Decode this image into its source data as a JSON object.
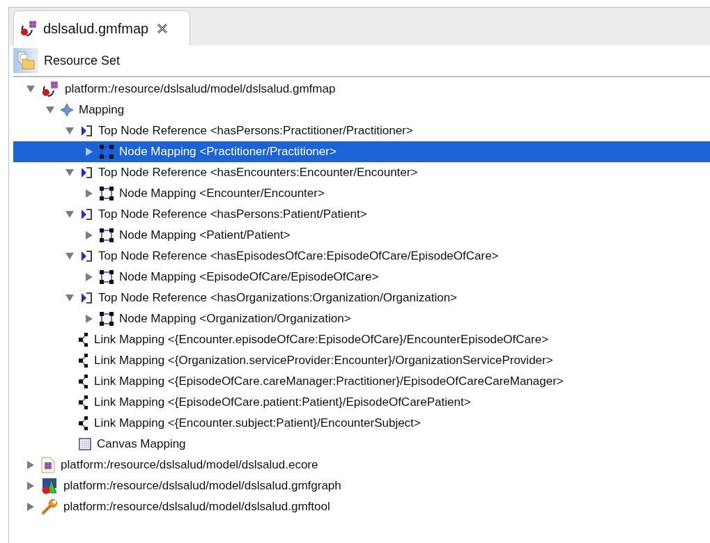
{
  "tab": {
    "title": "dslsalud.gmfmap",
    "selected": true
  },
  "header": {
    "label": "Resource Set"
  },
  "tree": [
    {
      "kind": "gmfmap",
      "label": "platform:/resource/dslsalud/model/dslsalud.gmfmap",
      "expanded": true,
      "selected": false,
      "children": [
        {
          "kind": "mapping",
          "label": "Mapping",
          "expanded": true,
          "selected": false,
          "children": [
            {
              "kind": "top-node",
              "label": "Top Node Reference <hasPersons:Practitioner/Practitioner>",
              "expanded": true,
              "selected": false,
              "children": [
                {
                  "kind": "node",
                  "label": "Node Mapping <Practitioner/Practitioner>",
                  "expanded": false,
                  "selected": true
                }
              ]
            },
            {
              "kind": "top-node",
              "label": "Top Node Reference <hasEncounters:Encounter/Encounter>",
              "expanded": true,
              "selected": false,
              "children": [
                {
                  "kind": "node",
                  "label": "Node Mapping <Encounter/Encounter>",
                  "expanded": false,
                  "selected": false
                }
              ]
            },
            {
              "kind": "top-node",
              "label": "Top Node Reference <hasPersons:Patient/Patient>",
              "expanded": true,
              "selected": false,
              "children": [
                {
                  "kind": "node",
                  "label": "Node Mapping <Patient/Patient>",
                  "expanded": false,
                  "selected": false
                }
              ]
            },
            {
              "kind": "top-node",
              "label": "Top Node Reference <hasEpisodesOfCare:EpisodeOfCare/EpisodeOfCare>",
              "expanded": true,
              "selected": false,
              "children": [
                {
                  "kind": "node",
                  "label": "Node Mapping <EpisodeOfCare/EpisodeOfCare>",
                  "expanded": false,
                  "selected": false
                }
              ]
            },
            {
              "kind": "top-node",
              "label": "Top Node Reference <hasOrganizations:Organization/Organization>",
              "expanded": true,
              "selected": false,
              "children": [
                {
                  "kind": "node",
                  "label": "Node Mapping <Organization/Organization>",
                  "expanded": false,
                  "selected": false
                }
              ]
            },
            {
              "kind": "link",
              "label": "Link Mapping <{Encounter.episodeOfCare:EpisodeOfCare}/EncounterEpisodeOfCare>",
              "selected": false
            },
            {
              "kind": "link",
              "label": "Link Mapping <{Organization.serviceProvider:Encounter}/OrganizationServiceProvider>",
              "selected": false
            },
            {
              "kind": "link",
              "label": "Link Mapping <{EpisodeOfCare.careManager:Practitioner}/EpisodeOfCareCareManager>",
              "selected": false
            },
            {
              "kind": "link",
              "label": "Link Mapping <{EpisodeOfCare.patient:Patient}/EpisodeOfCarePatient>",
              "selected": false
            },
            {
              "kind": "link",
              "label": "Link Mapping <{Encounter.subject:Patient}/EncounterSubject>",
              "selected": false
            },
            {
              "kind": "canvas",
              "label": "Canvas Mapping",
              "selected": false
            }
          ]
        }
      ]
    },
    {
      "kind": "ecore",
      "label": "platform:/resource/dslsalud/model/dslsalud.ecore",
      "expanded": false,
      "selected": false
    },
    {
      "kind": "gmfgraph",
      "label": "platform:/resource/dslsalud/model/dslsalud.gmfgraph",
      "expanded": false,
      "selected": false
    },
    {
      "kind": "gmftool",
      "label": "platform:/resource/dslsalud/model/dslsalud.gmftool",
      "expanded": false,
      "selected": false
    }
  ]
}
